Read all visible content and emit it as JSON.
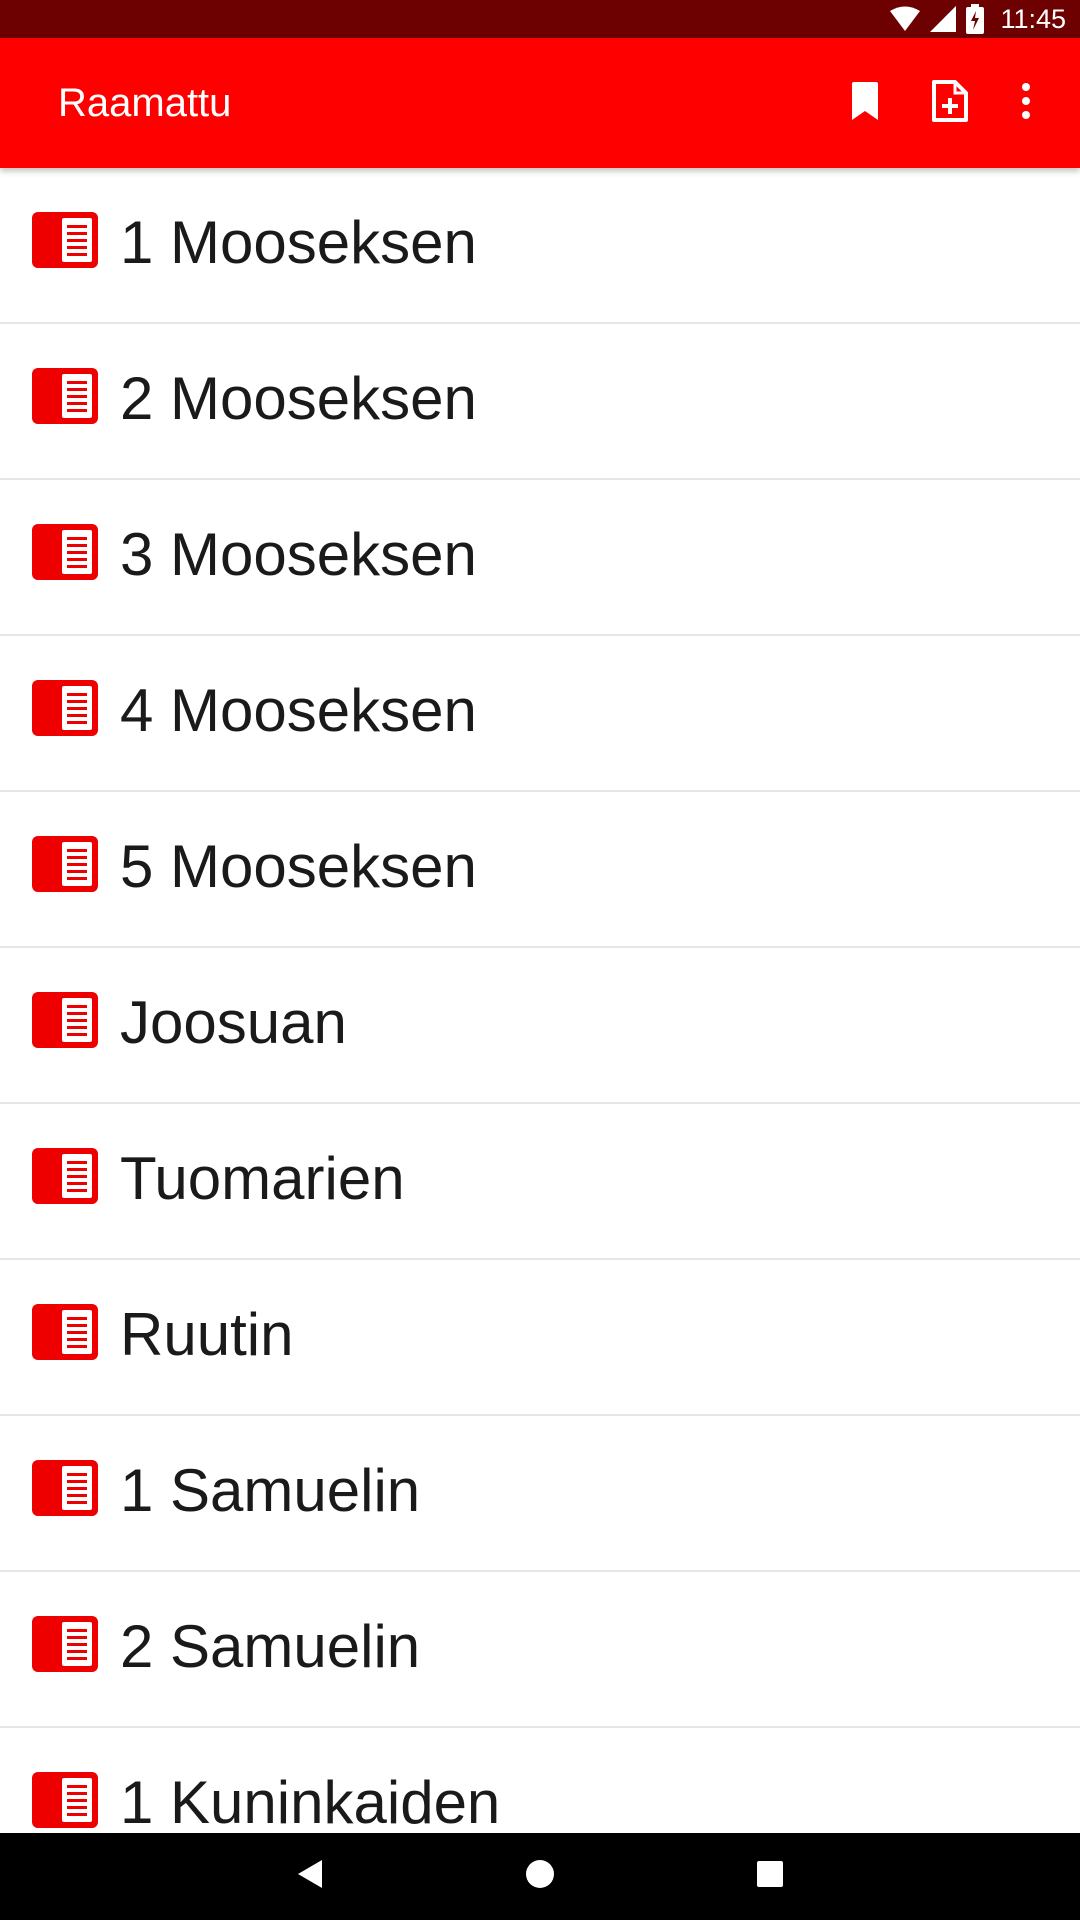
{
  "status_bar": {
    "time": "11:45",
    "icons": [
      "wifi-icon",
      "signal-icon",
      "battery-charging-icon"
    ]
  },
  "app_bar": {
    "title": "Raamattu",
    "actions": [
      "bookmark-icon",
      "add-page-icon",
      "more-vert-icon"
    ]
  },
  "colors": {
    "app_bar": "#ff0000",
    "status_bar": "#6d0000",
    "icon_red": "#ee0000",
    "text": "#1a1a1a",
    "divider": "#e6e6e6",
    "nav_bar": "#000000"
  },
  "books": [
    {
      "label": "1 Mooseksen"
    },
    {
      "label": "2 Mooseksen"
    },
    {
      "label": "3 Mooseksen"
    },
    {
      "label": "4 Mooseksen"
    },
    {
      "label": "5 Mooseksen"
    },
    {
      "label": "Joosuan"
    },
    {
      "label": "Tuomarien"
    },
    {
      "label": "Ruutin"
    },
    {
      "label": "1 Samuelin"
    },
    {
      "label": "2 Samuelin"
    },
    {
      "label": "1 Kuninkaiden"
    }
  ],
  "nav_bar": {
    "buttons": [
      "back-icon",
      "home-icon",
      "recents-icon"
    ]
  }
}
